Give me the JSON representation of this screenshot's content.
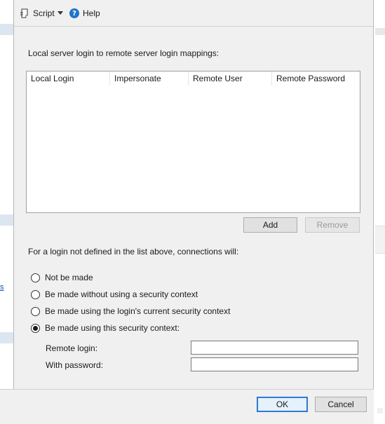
{
  "toolbar": {
    "script_label": "Script",
    "help_label": "Help"
  },
  "mappings": {
    "heading": "Local server login to remote server login mappings:",
    "columns": [
      "Local Login",
      "Impersonate",
      "Remote User",
      "Remote Password"
    ],
    "add_label": "Add",
    "remove_label": "Remove"
  },
  "connection": {
    "heading": "For a login not defined in the list above, connections will:",
    "options": [
      {
        "label": "Not be made",
        "checked": false
      },
      {
        "label": "Be made without using a security context",
        "checked": false
      },
      {
        "label": "Be made using the login's current security context",
        "checked": false
      },
      {
        "label": "Be made using this security context:",
        "checked": true
      }
    ],
    "remote_login_label": "Remote login:",
    "remote_login_value": "",
    "password_label": "With password:",
    "password_value": ""
  },
  "footer": {
    "ok_label": "OK",
    "cancel_label": "Cancel"
  },
  "left_partial_text": "s",
  "colors": {
    "panel_bg": "#f0f0f0",
    "accent": "#2f7ad0",
    "help_icon": "#1e74c8"
  },
  "icons": {
    "script": "script-icon",
    "dropdown": "chevron-down-icon",
    "help": "help-icon"
  }
}
